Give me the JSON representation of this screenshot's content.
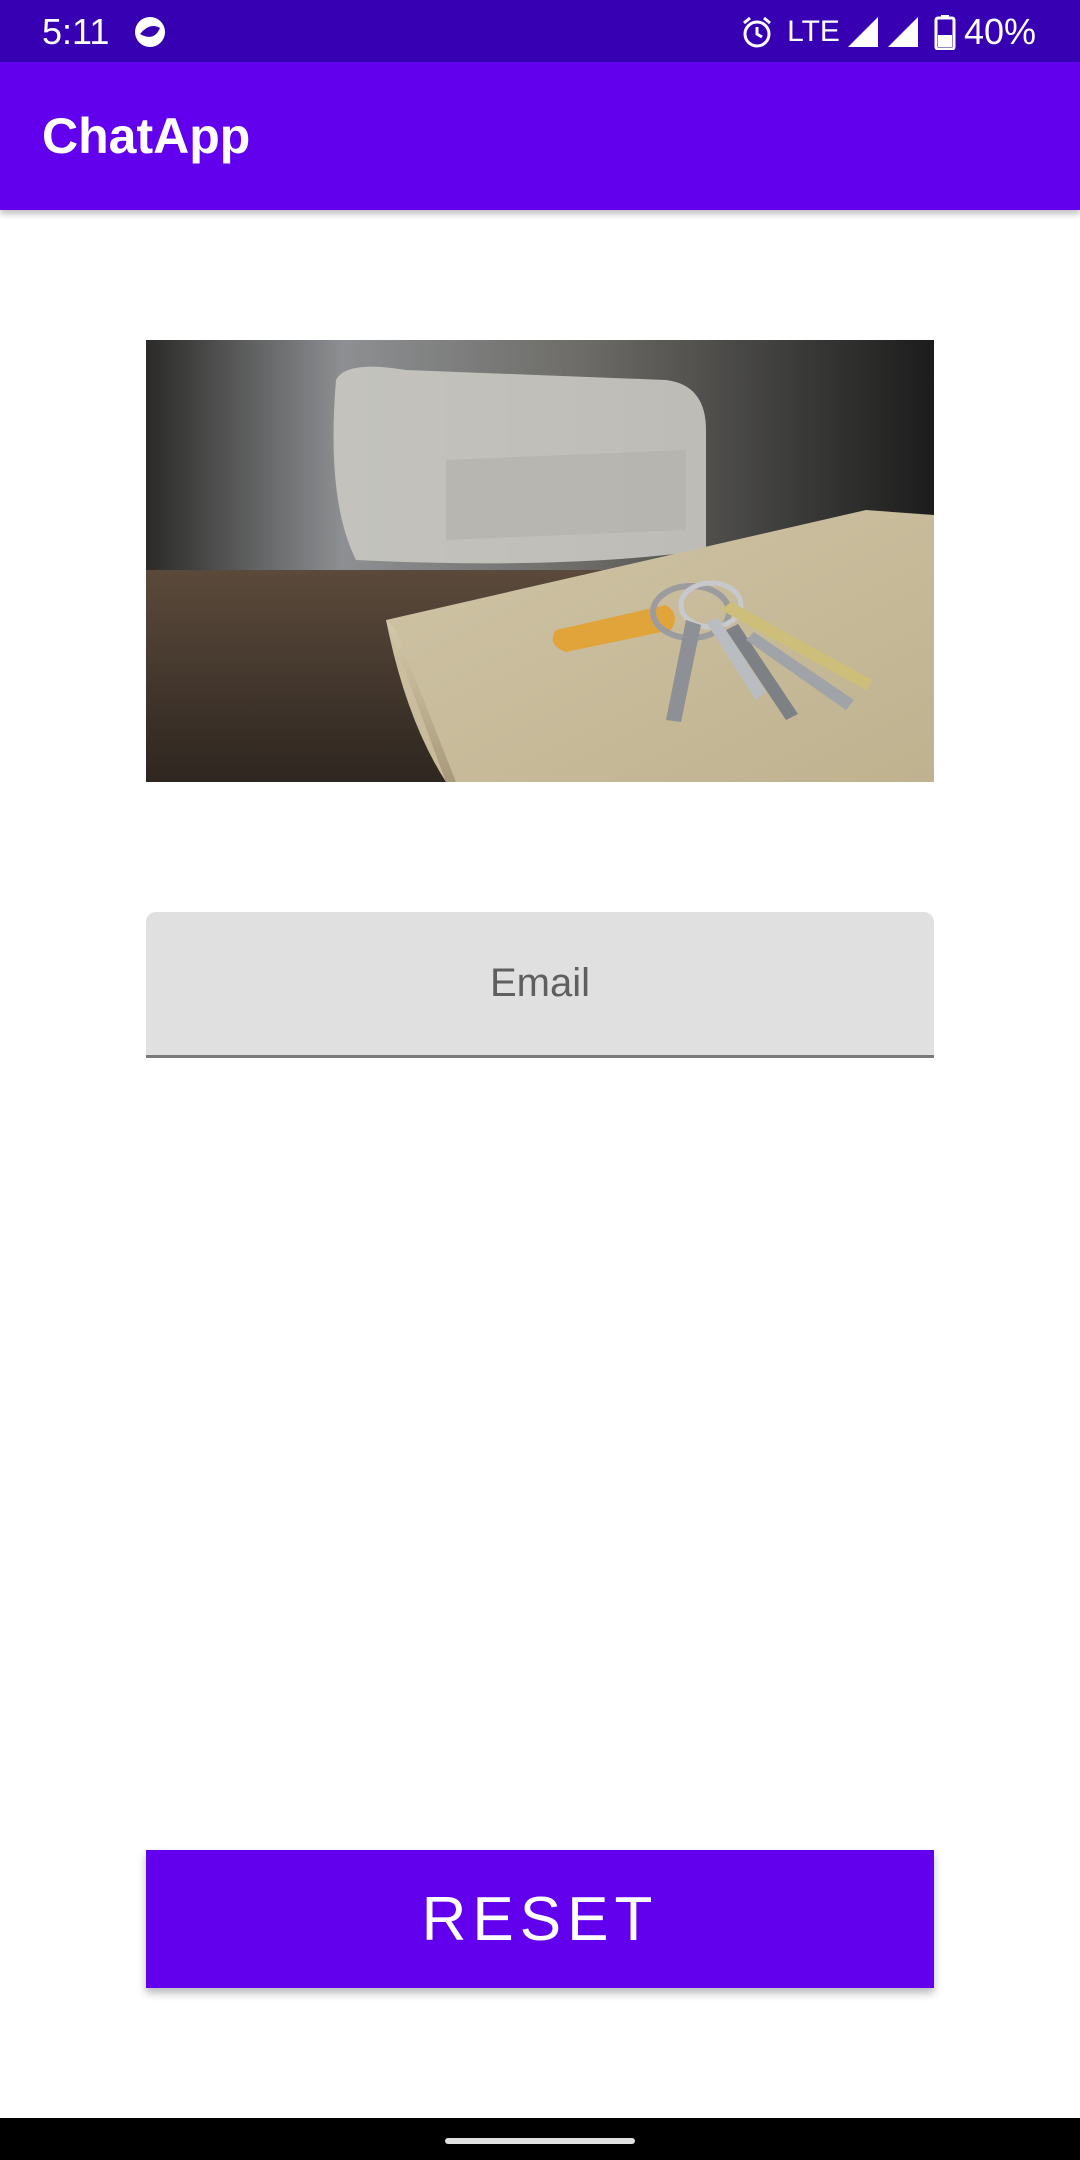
{
  "status_bar": {
    "time": "5:11",
    "network": "LTE",
    "battery": "40%",
    "icons": [
      "notification-icon",
      "alarm-icon",
      "signal-icon",
      "signal-icon",
      "battery-icon"
    ]
  },
  "app_bar": {
    "title": "ChatApp"
  },
  "hero_image": {
    "icon": "keys-on-table-photo"
  },
  "form": {
    "email_placeholder": "Email",
    "email_value": ""
  },
  "actions": {
    "reset_label": "RESET"
  },
  "colors": {
    "status_bar": "#3700b3",
    "primary": "#6200ee",
    "field_bg": "#e0e0e0",
    "nav_bar": "#000000"
  }
}
